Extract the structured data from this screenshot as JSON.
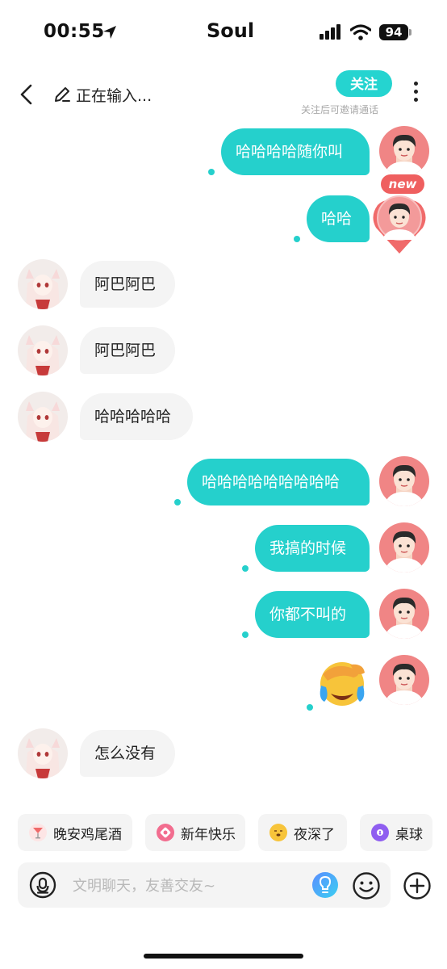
{
  "status_bar": {
    "time": "00:55",
    "battery": "94",
    "carrier_app": "Soul"
  },
  "header": {
    "typing_status": "正在输入...",
    "follow_label": "关注",
    "follow_hint": "关注后可邀请通话"
  },
  "avatar_badge": "new",
  "messages": [
    {
      "dir": "out",
      "text": "哈哈哈哈随你叫"
    },
    {
      "dir": "out",
      "text": "哈哈"
    },
    {
      "dir": "in",
      "text": "阿巴阿巴"
    },
    {
      "dir": "in",
      "text": "阿巴阿巴"
    },
    {
      "dir": "in",
      "text": "哈哈哈哈哈"
    },
    {
      "dir": "out",
      "text": "哈哈哈哈哈哈哈哈哈"
    },
    {
      "dir": "out",
      "text": "我搞的时候"
    },
    {
      "dir": "out",
      "text": "你都不叫的"
    },
    {
      "dir": "out",
      "text": "",
      "emoji": "face-with-hand-over-eyes-crying"
    },
    {
      "dir": "in",
      "text": "怎么没有"
    }
  ],
  "quick_replies": [
    {
      "label": "晚安鸡尾酒",
      "icon": "cocktail-icon"
    },
    {
      "label": "新年快乐",
      "icon": "new-year-icon"
    },
    {
      "label": "夜深了",
      "icon": "sleepy-face-icon"
    },
    {
      "label": "桌球",
      "icon": "billiard-ball-icon"
    }
  ],
  "composer": {
    "placeholder": "文明聊天，友善交友~"
  },
  "colors": {
    "accent": "#25d0cc",
    "my_avatar": "#f08585",
    "badge": "#ef5f5f"
  }
}
